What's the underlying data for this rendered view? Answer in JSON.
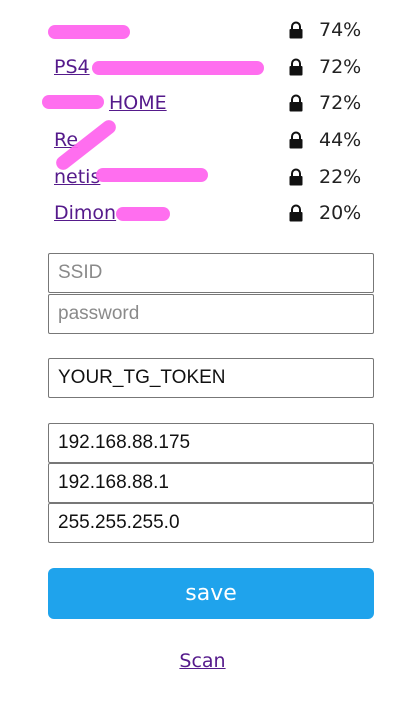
{
  "networks": [
    {
      "name": "",
      "signal": "74%"
    },
    {
      "name": "PS4",
      "signal": "72%"
    },
    {
      "name": "HOME",
      "signal": "72%"
    },
    {
      "name": "Re",
      "signal": "44%"
    },
    {
      "name": "netis",
      "signal": "22%"
    },
    {
      "name": "Dimon",
      "signal": "20%"
    }
  ],
  "form": {
    "ssid_placeholder": "SSID",
    "password_placeholder": "password",
    "token_value": "YOUR_TG_TOKEN",
    "ip_value": "192.168.88.175",
    "gateway_value": "192.168.88.1",
    "subnet_value": "255.255.255.0"
  },
  "save_label": "save",
  "scan_label": "Scan",
  "colors": {
    "button": "#1fa3ec",
    "link": "#551a8b",
    "redaction": "#ff66ee"
  },
  "icons": {
    "secured": "lock-icon"
  }
}
